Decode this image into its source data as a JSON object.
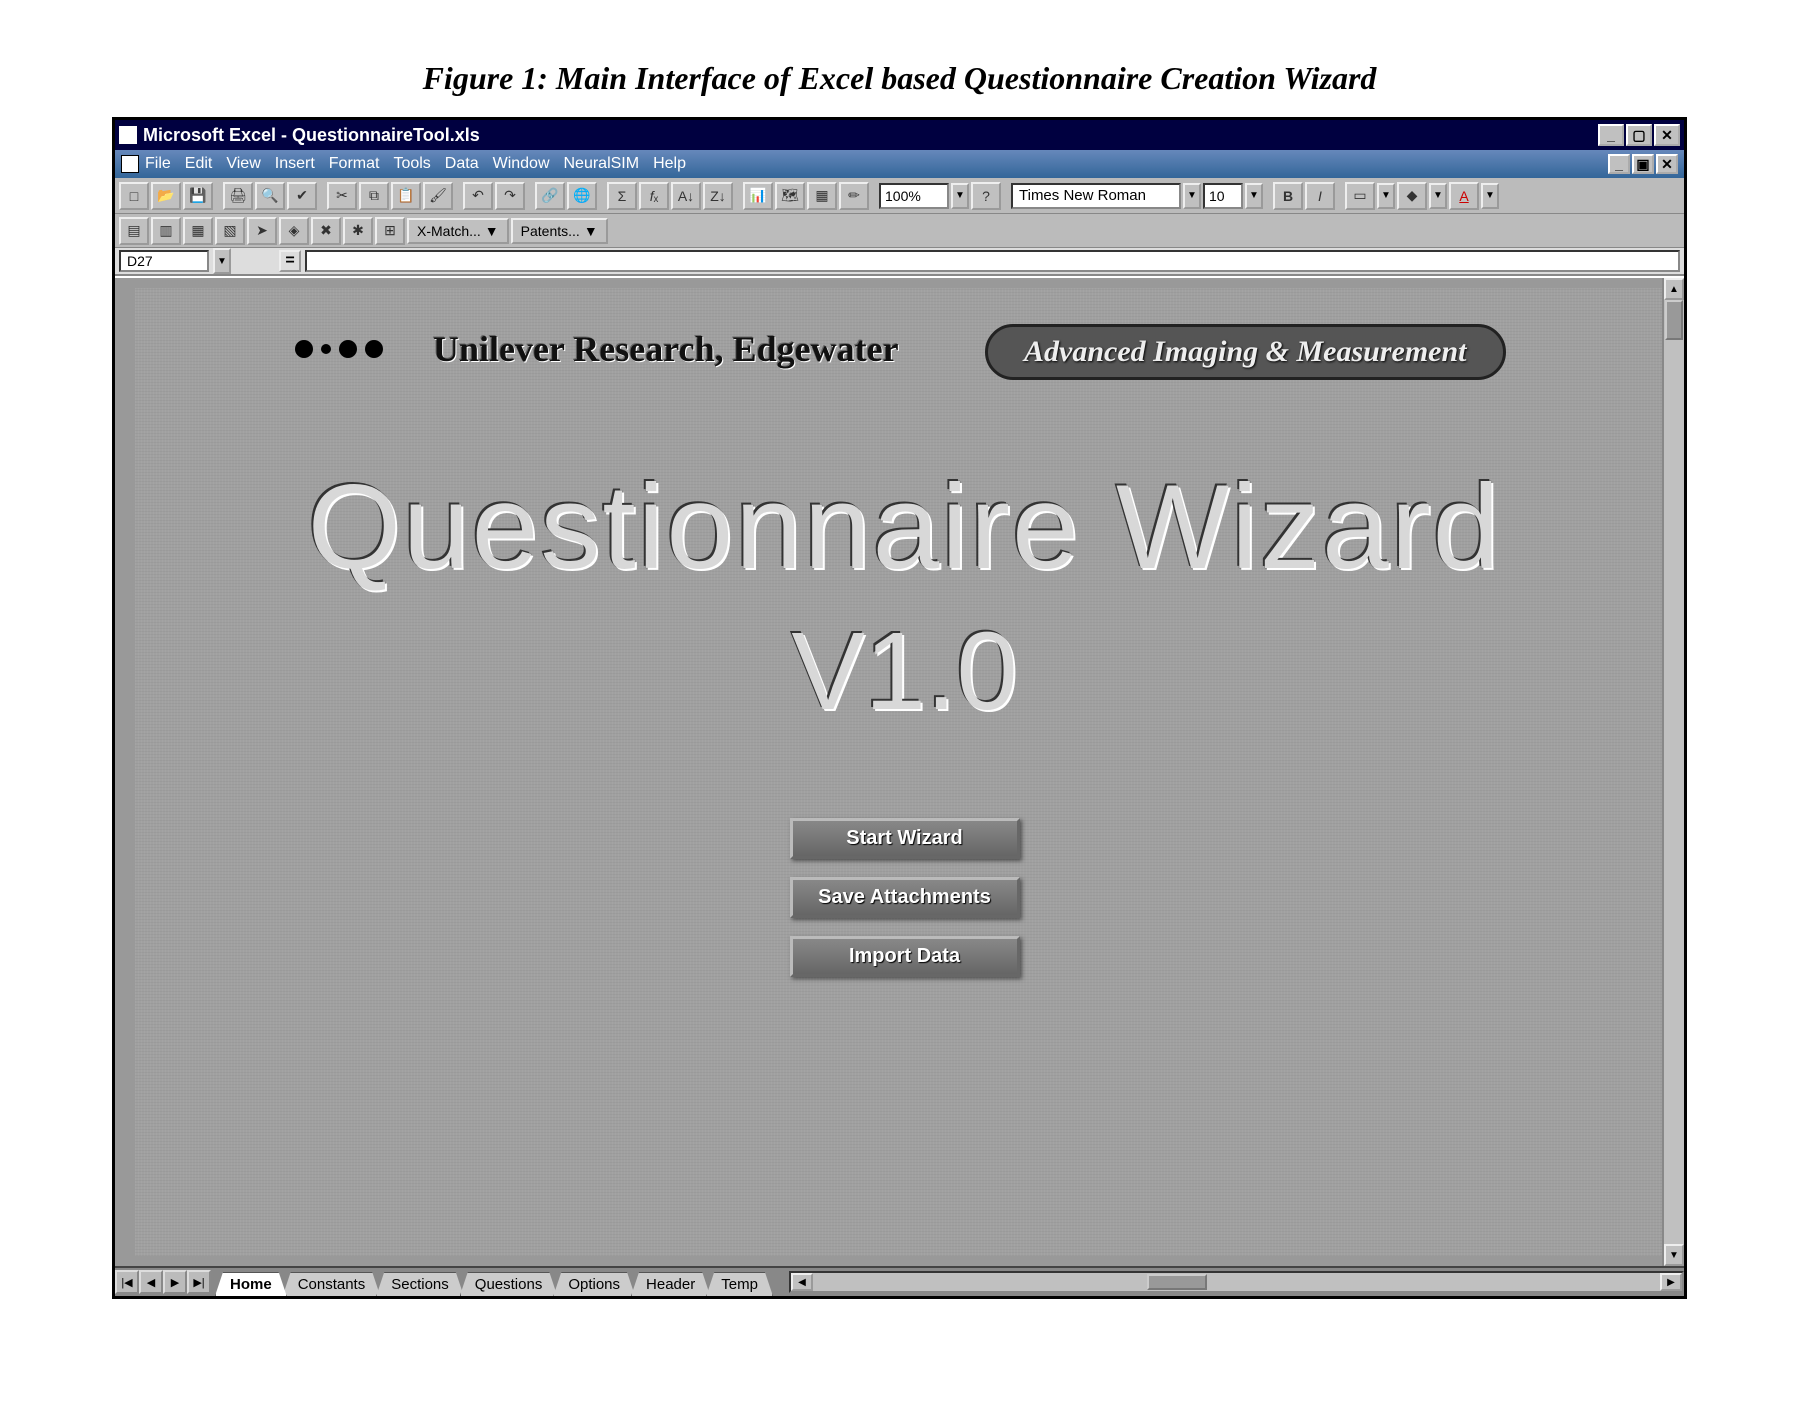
{
  "figure_caption": "Figure 1: Main Interface of Excel based Questionnaire Creation Wizard",
  "title_bar": {
    "app_title": "Microsoft Excel - QuestionnaireTool.xls"
  },
  "menu": {
    "items": [
      "File",
      "Edit",
      "View",
      "Insert",
      "Format",
      "Tools",
      "Data",
      "Window",
      "NeuralSIM",
      "Help"
    ]
  },
  "toolbar_main": {
    "zoom": "100%",
    "font_name": "Times New Roman",
    "font_size": "10"
  },
  "toolbar_custom": {
    "btn1": "X-Match...",
    "btn2": "Patents..."
  },
  "name_box": "D27",
  "formula_value": "=",
  "worksheet": {
    "org_name": "Unilever Research, Edgewater",
    "dept_badge": "Advanced Imaging & Measurement",
    "big_title": "Questionnaire Wizard",
    "big_version": "V1.0",
    "buttons": {
      "start": "Start Wizard",
      "save": "Save Attachments",
      "import": "Import Data"
    }
  },
  "sheet_tabs": [
    "Home",
    "Constants",
    "Sections",
    "Questions",
    "Options",
    "Header",
    "Temp"
  ],
  "active_tab_index": 0
}
